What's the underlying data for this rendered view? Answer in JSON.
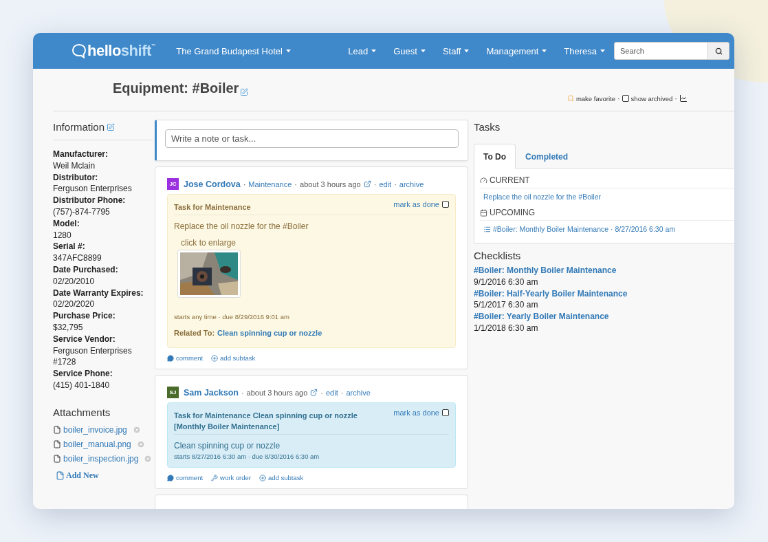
{
  "separator": "·",
  "nav": {
    "brand": {
      "hello": "hello",
      "shift": "shift",
      "mark": "™"
    },
    "hotel": "The Grand Budapest Hotel",
    "menus": [
      "Lead",
      "Guest",
      "Staff",
      "Management",
      "Theresa"
    ],
    "search": {
      "placeholder": "Search"
    }
  },
  "page": {
    "title": "Equipment: #Boiler",
    "actions": [
      {
        "kind": "favorite",
        "label": "make favorite"
      },
      {
        "kind": "checkbox",
        "label": "show archived",
        "checked": false
      },
      {
        "kind": "chart"
      }
    ]
  },
  "information": {
    "heading": "Information",
    "fields": [
      {
        "label": "Manufacturer:",
        "value": "Weil Mclain"
      },
      {
        "label": "Distributor:",
        "value": "Ferguson Enterprises"
      },
      {
        "label": "Distributor Phone:",
        "value": "(757)-874-7795"
      },
      {
        "label": "Model:",
        "value": "1280"
      },
      {
        "label": "Serial #:",
        "value": "347AFC8899"
      },
      {
        "label": "Date Purchased:",
        "value": "02/20/2010"
      },
      {
        "label": "Date Warranty Expires:",
        "value": "02/20/2020"
      },
      {
        "label": "Purchase Price:",
        "value": "$32,795"
      },
      {
        "label": "Service Vendor:",
        "value": "Ferguson Enterprises #1728"
      },
      {
        "label": "Service Phone:",
        "value": "(415) 401-1840"
      }
    ]
  },
  "attachments": {
    "heading": "Attachments",
    "files": [
      "boiler_invoice.jpg",
      "boiler_manual.png",
      "boiler_inspection.jpg"
    ],
    "add": "Add New"
  },
  "composer": {
    "placeholder": "Write a note or task..."
  },
  "posts": [
    {
      "initials": "JC",
      "color": "#9b30e0",
      "author": "Jose Cordova",
      "category": "Maintenance",
      "time": "about 3 hours ago",
      "links": [
        "edit",
        "archive"
      ],
      "task": {
        "kind": "warning",
        "title": "Task for Maintenance",
        "mark": "mark as done",
        "done": false,
        "body": "Replace the oil nozzle for the #Boiler",
        "caption": "click to enlarge",
        "schedule": "starts any time · due 8/29/2016 9:01 am",
        "related_label": "Related To:",
        "related": "Clean spinning cup or nozzle"
      },
      "actions": [
        {
          "kind": "comment",
          "label": "comment"
        },
        {
          "kind": "subtask",
          "label": "add subtask"
        }
      ]
    },
    {
      "initials": "SJ",
      "color": "#4a6b2a",
      "author": "Sam Jackson",
      "time": "about 3 hours ago",
      "links": [
        "edit",
        "archive"
      ],
      "task": {
        "kind": "info",
        "title": "Task for Maintenance Clean spinning cup or nozzle [Monthly Boiler Maintenance]",
        "mark": "mark as done",
        "done": false,
        "body": "Clean spinning cup or nozzle",
        "schedule": "starts 8/27/2016 6:30 am · due 8/30/2016 6:30 am"
      },
      "actions": [
        {
          "kind": "comment",
          "label": "comment"
        },
        {
          "kind": "workorder",
          "label": "work order"
        },
        {
          "kind": "subtask",
          "label": "add subtask"
        }
      ]
    }
  ],
  "tasks": {
    "heading": "Tasks",
    "tabs": [
      {
        "label": "To Do",
        "selected": true
      },
      {
        "label": "Completed",
        "selected": false
      }
    ],
    "groups": [
      {
        "kind": "current",
        "label": "CURRENT",
        "items": [
          {
            "kind": "plain",
            "text": "Replace the oil nozzle for the #Boiler"
          }
        ]
      },
      {
        "kind": "upcoming",
        "label": "UPCOMING",
        "items": [
          {
            "kind": "list",
            "text": "#Boiler: Monthly Boiler Maintenance · 8/27/2016 6:30 am"
          }
        ]
      }
    ]
  },
  "checklists": {
    "heading": "Checklists",
    "items": [
      {
        "name": "#Boiler: Monthly Boiler Maintenance",
        "date": "9/1/2016 6:30 am"
      },
      {
        "name": "#Boiler: Half-Yearly Boiler Maintenance",
        "date": "5/1/2017 6:30 am"
      },
      {
        "name": "#Boiler: Yearly Boiler Maintenance",
        "date": "1/1/2018 6:30 am"
      }
    ]
  }
}
